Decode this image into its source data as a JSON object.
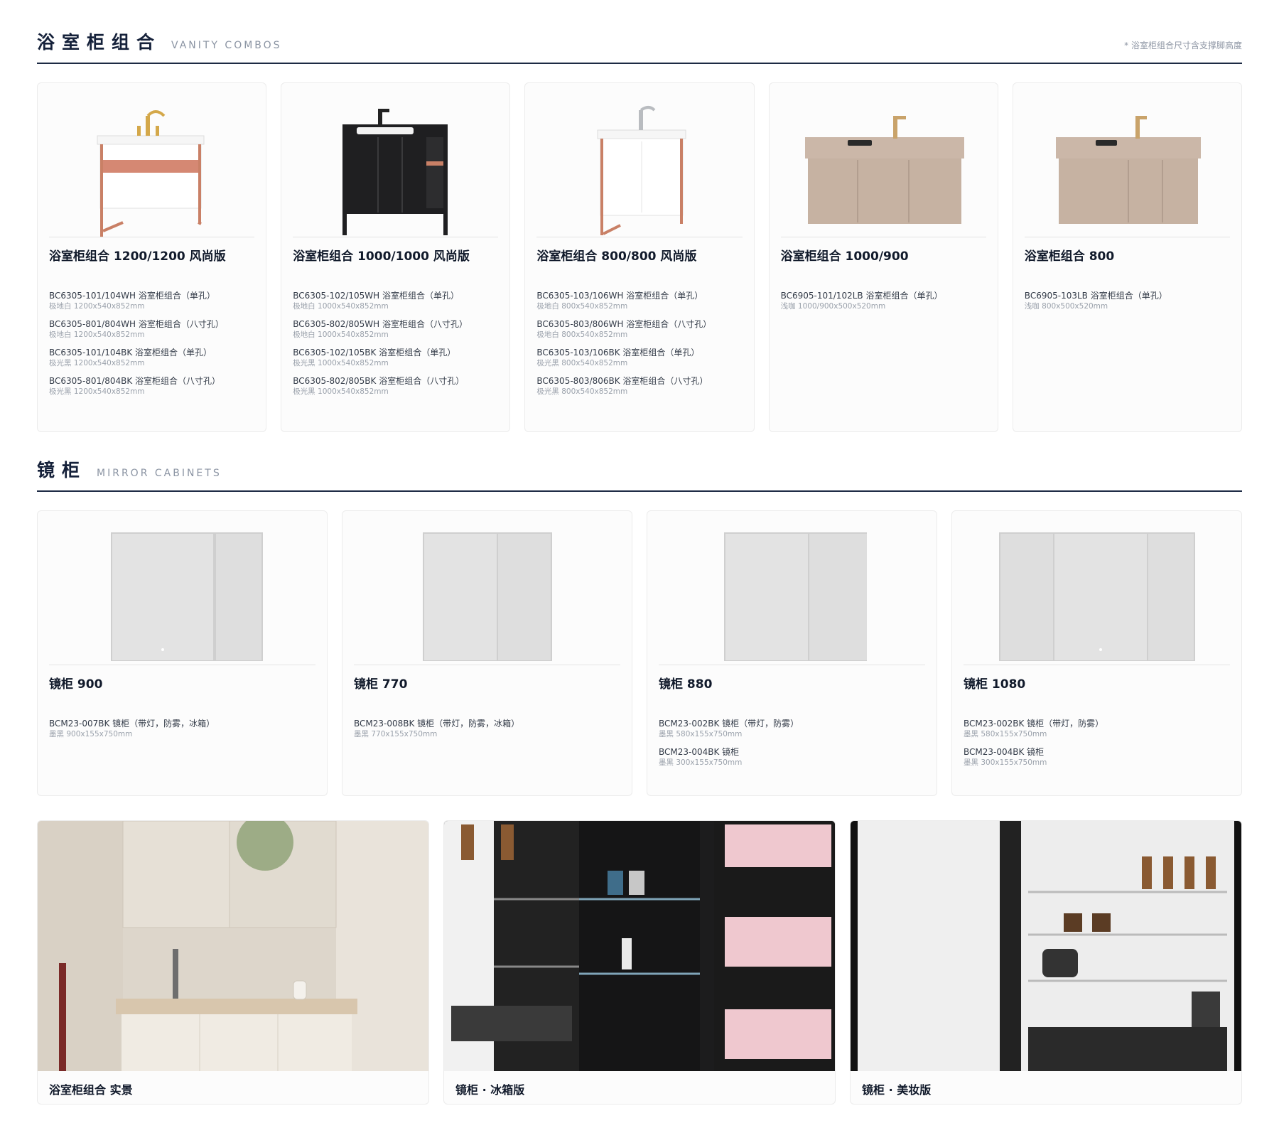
{
  "vanity_section": {
    "title": "浴室柜组合",
    "subtitle": "VANITY COMBOS",
    "note": "* 浴室柜组合尺寸含支撑脚高度",
    "cards": [
      {
        "title": "浴室柜组合 1200/1200 风尚版",
        "image": "vanity-white-gold-faucet",
        "skus": [
          {
            "code": "BC6305-101/104WH 浴室柜组合（单孔）",
            "spec": "极地白 1200x540x852mm"
          },
          {
            "code": "BC6305-801/804WH 浴室柜组合（八寸孔）",
            "spec": "极地白 1200x540x852mm"
          },
          {
            "code": "BC6305-101/104BK 浴室柜组合（单孔）",
            "spec": "极光黑 1200x540x852mm"
          },
          {
            "code": "BC6305-801/804BK 浴室柜组合（八寸孔）",
            "spec": "极光黑 1200x540x852mm"
          }
        ]
      },
      {
        "title": "浴室柜组合 1000/1000 风尚版",
        "image": "vanity-black",
        "skus": [
          {
            "code": "BC6305-102/105WH 浴室柜组合（单孔）",
            "spec": "极地白 1000x540x852mm"
          },
          {
            "code": "BC6305-802/805WH 浴室柜组合（八寸孔）",
            "spec": "极地白 1000x540x852mm"
          },
          {
            "code": "BC6305-102/105BK 浴室柜组合（单孔）",
            "spec": "极光黑 1000x540x852mm"
          },
          {
            "code": "BC6305-802/805BK 浴室柜组合（八寸孔）",
            "spec": "极光黑 1000x540x852mm"
          }
        ]
      },
      {
        "title": "浴室柜组合 800/800 风尚版",
        "image": "vanity-white-chrome-faucet",
        "skus": [
          {
            "code": "BC6305-103/106WH 浴室柜组合（单孔）",
            "spec": "极地白 800x540x852mm"
          },
          {
            "code": "BC6305-803/806WH 浴室柜组合（八寸孔）",
            "spec": "极地白 800x540x852mm"
          },
          {
            "code": "BC6305-103/106BK 浴室柜组合（单孔）",
            "spec": "极光黑 800x540x852mm"
          },
          {
            "code": "BC6305-803/806BK 浴室柜组合（八寸孔）",
            "spec": "极光黑 800x540x852mm"
          }
        ]
      },
      {
        "title": "浴室柜组合 1000/900",
        "image": "vanity-wallhung-beige-3door",
        "skus": [
          {
            "code": "BC6905-101/102LB 浴室柜组合（单孔）",
            "spec": "浅咖 1000/900x500x520mm"
          }
        ]
      },
      {
        "title": "浴室柜组合 800",
        "image": "vanity-wallhung-beige-2door",
        "skus": [
          {
            "code": "BC6905-103LB 浴室柜组合（单孔）",
            "spec": "浅咖 800x500x520mm"
          }
        ]
      }
    ]
  },
  "mirror_section": {
    "title": "镜柜",
    "subtitle": "MIRROR CABINETS",
    "cards": [
      {
        "title": "镜柜 900",
        "image": "mirror-cabinet-wide-narrow",
        "skus": [
          {
            "code": "BCM23-007BK 镜柜（带灯，防雾，冰箱）",
            "spec": "墨黑 900x155x750mm"
          }
        ]
      },
      {
        "title": "镜柜 770",
        "image": "mirror-cabinet-two-door",
        "skus": [
          {
            "code": "BCM23-008BK 镜柜（带灯，防雾，冰箱）",
            "spec": "墨黑 770x155x750mm"
          }
        ]
      },
      {
        "title": "镜柜 880",
        "image": "mirror-cabinet-combo",
        "skus": [
          {
            "code": "BCM23-002BK 镜柜（带灯，防雾）",
            "spec": "墨黑 580x155x750mm"
          },
          {
            "code": "BCM23-004BK 镜柜",
            "spec": "墨黑 300x155x750mm"
          }
        ]
      },
      {
        "title": "镜柜 1080",
        "image": "mirror-cabinet-three-door",
        "skus": [
          {
            "code": "BCM23-002BK 镜柜（带灯，防雾）",
            "spec": "墨黑 580x155x750mm"
          },
          {
            "code": "BCM23-004BK 镜柜",
            "spec": "墨黑 300x155x750mm"
          }
        ]
      }
    ]
  },
  "scenes": [
    {
      "caption": "浴室柜组合 实景",
      "image": "bathroom-scene-photo"
    },
    {
      "caption": "镜柜 · 冰箱版",
      "image": "mirror-fridge-interior-photo"
    },
    {
      "caption": "镜柜 · 美妆版",
      "image": "mirror-makeup-interior-photo"
    }
  ],
  "colors": {
    "accent_navy": "#15213a",
    "rose_gold": "#c98066",
    "beige_cabinet": "#cbb7a8",
    "black_cabinet": "#1f1f21"
  }
}
